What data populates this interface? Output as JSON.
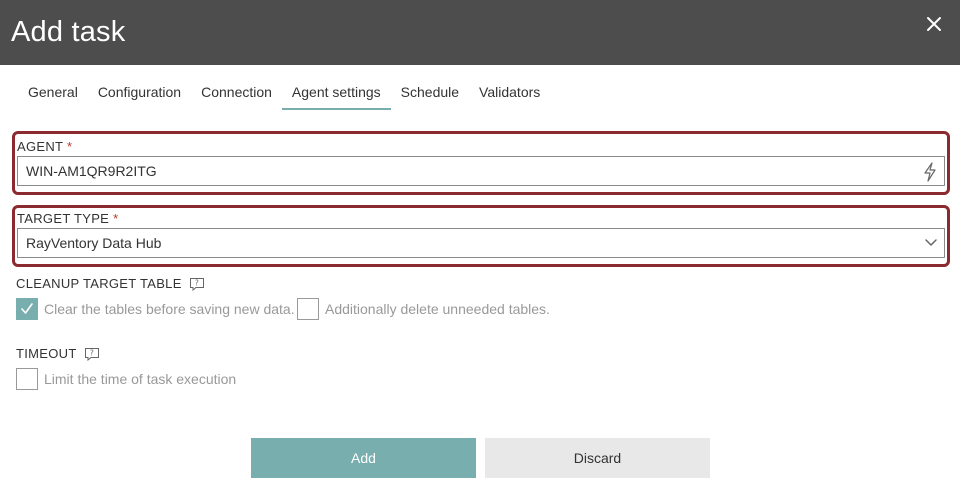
{
  "dialog": {
    "title": "Add task"
  },
  "tabs": [
    {
      "label": "General"
    },
    {
      "label": "Configuration"
    },
    {
      "label": "Connection"
    },
    {
      "label": "Agent settings",
      "active": true
    },
    {
      "label": "Schedule"
    },
    {
      "label": "Validators"
    }
  ],
  "agent": {
    "label": "AGENT",
    "required_mark": "*",
    "value": "WIN-AM1QR9R2ITG"
  },
  "target_type": {
    "label": "TARGET TYPE",
    "required_mark": "*",
    "value": "RayVentory Data Hub"
  },
  "cleanup": {
    "label": "CLEANUP TARGET TABLE",
    "clear_tables": {
      "label": "Clear the tables before saving new data.",
      "checked": true
    },
    "delete_unneeded": {
      "label": "Additionally delete unneeded tables.",
      "checked": false
    }
  },
  "timeout": {
    "label": "TIMEOUT",
    "limit_time": {
      "label": "Limit the time of task execution",
      "checked": false
    }
  },
  "buttons": {
    "add_label": "Add",
    "discard_label": "Discard"
  },
  "colors": {
    "header": "#4d4d4d",
    "accent": "#78aeae",
    "highlight_border": "#8b2a2f",
    "required": "#c0392b"
  }
}
